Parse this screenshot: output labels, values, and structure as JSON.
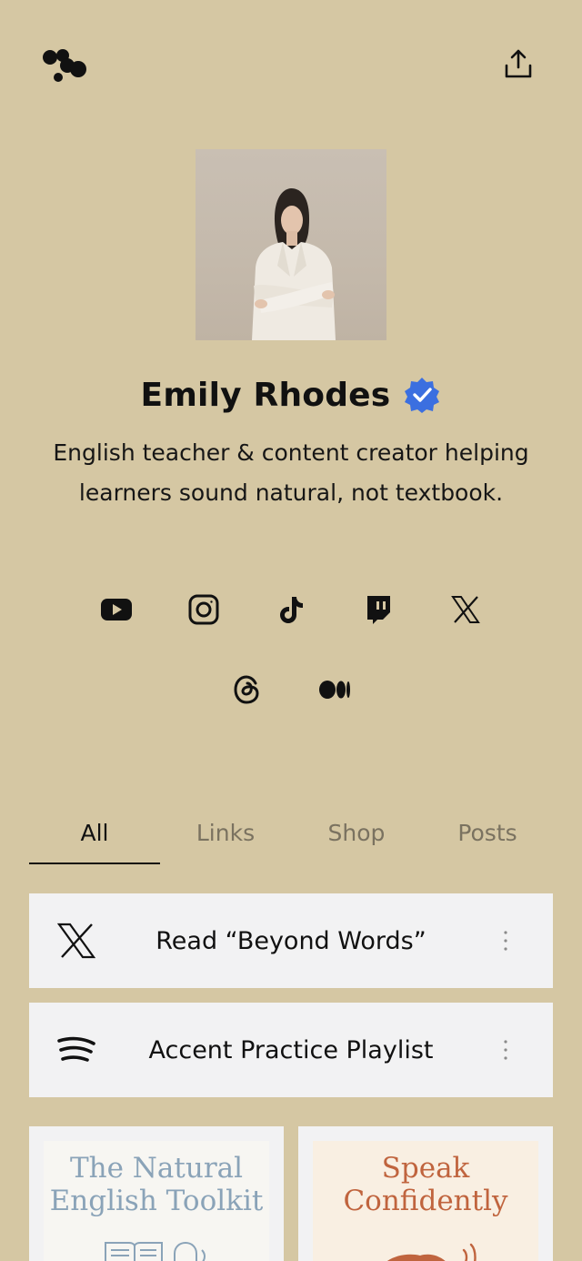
{
  "profile": {
    "name": "Emily Rhodes",
    "bio": "English teacher & content creator helping learners sound natural, not textbook."
  },
  "icons": {
    "logo": "linktree-style-logo-icon",
    "share": "share-upload-icon",
    "verified": "verified-badge-icon"
  },
  "socials": [
    {
      "name": "youtube-icon"
    },
    {
      "name": "instagram-icon"
    },
    {
      "name": "tiktok-icon"
    },
    {
      "name": "twitch-icon"
    },
    {
      "name": "x-icon"
    },
    {
      "name": "threads-icon"
    },
    {
      "name": "medium-icon"
    }
  ],
  "tabs": [
    {
      "label": "All",
      "active": true
    },
    {
      "label": "Links",
      "active": false
    },
    {
      "label": "Shop",
      "active": false
    },
    {
      "label": "Posts",
      "active": false
    }
  ],
  "links": [
    {
      "label": "Read “Beyond Words”",
      "icon": "x-icon"
    },
    {
      "label": "Accent Practice Playlist",
      "icon": "spotify-icon"
    }
  ],
  "products": [
    {
      "title": "The Natural English Toolkit",
      "color": "#8aa3b8"
    },
    {
      "title": "Speak Confidently",
      "color": "#c0643e"
    }
  ],
  "colors": {
    "background": "#d5c7a3",
    "card": "#f2f2f3",
    "verified": "#3b6fe0"
  }
}
